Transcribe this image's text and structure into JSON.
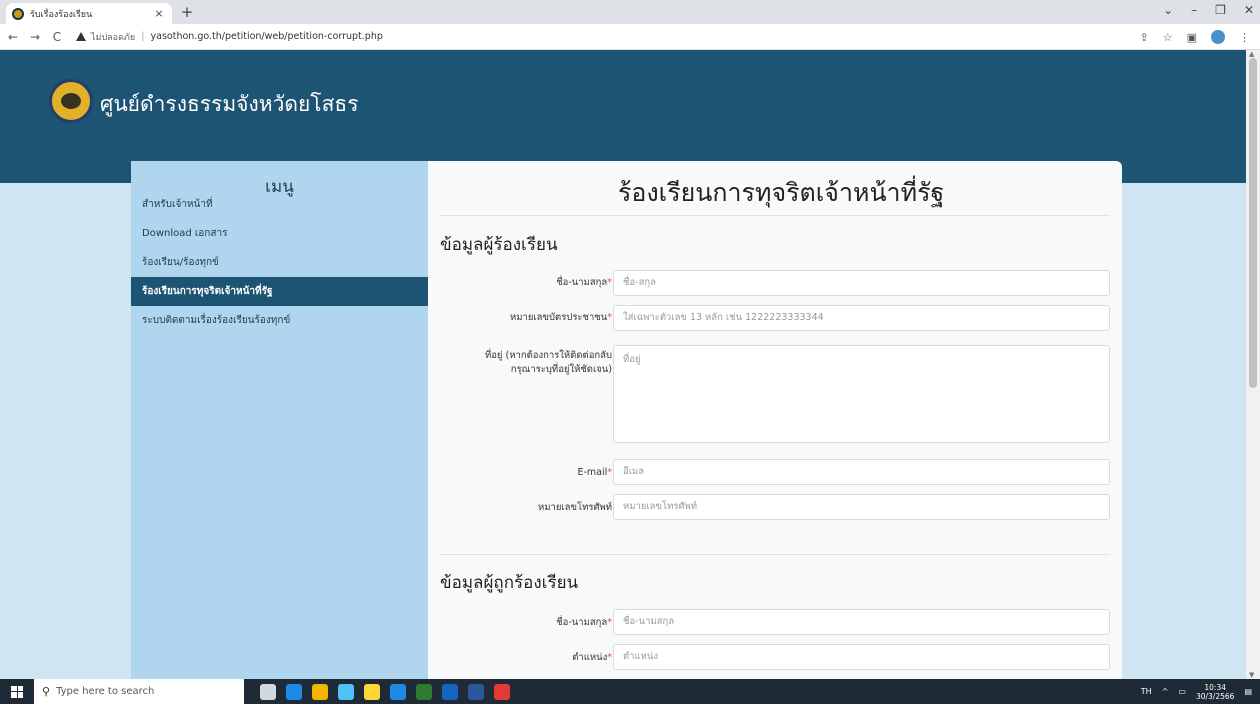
{
  "browser": {
    "tab_title": "รับเรื่องร้องเรียน",
    "tab_close": "×",
    "new_tab": "+",
    "security_label": "ไม่ปลอดภัย",
    "url": "yasothon.go.th/petition/web/petition-corrupt.php",
    "window_controls": [
      "⌄",
      "–",
      "❐",
      "✕"
    ]
  },
  "site": {
    "title": "ศูนย์ดำรงธรรมจังหวัดยโสธร"
  },
  "sidebar": {
    "heading": "เมนู",
    "items": [
      {
        "label": "สำหรับเจ้าหน้าที่",
        "active": false
      },
      {
        "label": "Download เอกสาร",
        "active": false
      },
      {
        "label": "ร้องเรียน/ร้องทุกข์",
        "active": false
      },
      {
        "label": "ร้องเรียนการทุจริตเจ้าหน้าที่รัฐ",
        "active": true
      },
      {
        "label": "ระบบติดตามเรื่องร้องเรียนร้องทุกข์",
        "active": false
      }
    ]
  },
  "form": {
    "title": "ร้องเรียนการทุจริตเจ้าหน้าที่รัฐ",
    "required_mark": "*",
    "complainant": {
      "heading": "ข้อมูลผู้ร้องเรียน",
      "name_label": "ชื่อ-นามสกุล",
      "name_placeholder": "ชื่อ-สกุล",
      "id_label": "หมายเลขบัตรประชาชน",
      "id_placeholder": "ใส่เฉพาะตัวเลข 13 หลัก เช่น 1222223333344",
      "address_label_1": "ที่อยู่ (หากต้องการให้ติดต่อกลับ",
      "address_label_2": "กรุณาระบุที่อยู่ให้ชัดเจน)",
      "address_placeholder": "ที่อยู่",
      "email_label": "E-mail",
      "email_placeholder": "อีเมล",
      "phone_label": "หมายเลขโทรศัพท์",
      "phone_placeholder": "หมายเลขโทรศัพท์"
    },
    "accused": {
      "heading": "ข้อมูลผู้ถูกร้องเรียน",
      "name_label": "ชื่อ-นามสกุล",
      "name_placeholder": "ชื่อ-นามสกุล",
      "position_label": "ตำแหน่ง",
      "position_placeholder": "ตำแหน่ง"
    }
  },
  "taskbar": {
    "search_placeholder": "Type here to search",
    "language": "TH",
    "time": "10:34",
    "date": "30/3/2566",
    "icon_colors": [
      "#cfd8dc",
      "#1e88e5",
      "#f4b400",
      "#4fc3f7",
      "#fdd835",
      "#1e88e5",
      "#2e7d32",
      "#1565c0",
      "#2b579a",
      "#e53935"
    ]
  }
}
